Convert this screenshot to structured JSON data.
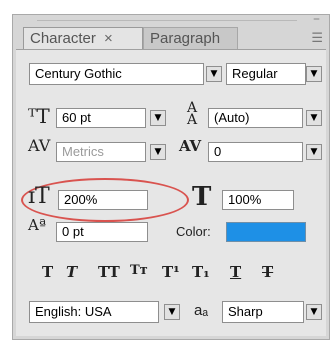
{
  "tabs": [
    {
      "label": "Character",
      "close": "×"
    },
    {
      "label": "Paragraph"
    }
  ],
  "panel": {
    "minimize": "–",
    "menu": "☰"
  },
  "font": {
    "family": "Century Gothic",
    "style": "Regular"
  },
  "size": {
    "value": "60 pt"
  },
  "leading": {
    "value": "(Auto)"
  },
  "kerning": {
    "value": "Metrics"
  },
  "tracking": {
    "value": "0"
  },
  "vertical_scale": {
    "value": "200%"
  },
  "horizontal_scale": {
    "value": "100%"
  },
  "baseline_shift": {
    "value": "0 pt"
  },
  "color": {
    "label": "Color:",
    "value": "#1e90e6"
  },
  "style_buttons": [
    "T",
    "T",
    "TT",
    "Tт",
    "T¹",
    "T₁",
    "T",
    "T"
  ],
  "language": {
    "value": "English: USA"
  },
  "antialias": {
    "label": "aₐ",
    "value": "Sharp"
  },
  "highlight_color": "#d9534f"
}
